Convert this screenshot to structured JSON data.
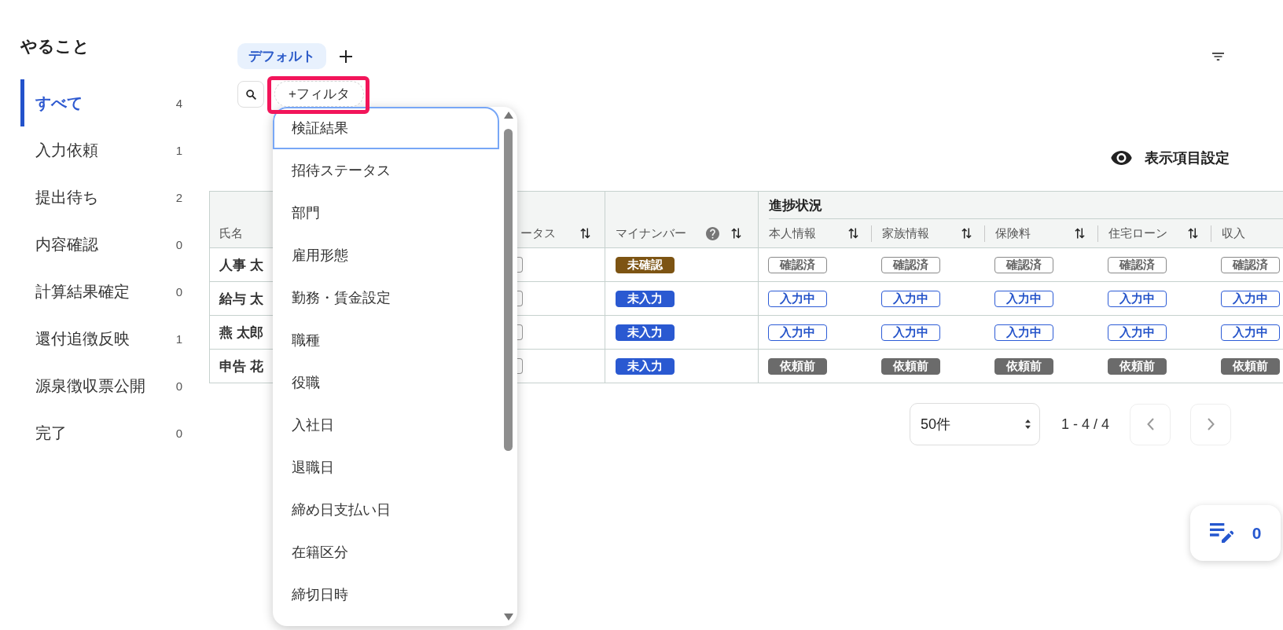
{
  "sidebar": {
    "title": "やること",
    "items": [
      {
        "label": "すべて",
        "count": "4",
        "selected": true
      },
      {
        "label": "入力依頼",
        "count": "1",
        "selected": false
      },
      {
        "label": "提出待ち",
        "count": "2",
        "selected": false
      },
      {
        "label": "内容確認",
        "count": "0",
        "selected": false
      },
      {
        "label": "計算結果確定",
        "count": "0",
        "selected": false
      },
      {
        "label": "還付追徴反映",
        "count": "1",
        "selected": false
      },
      {
        "label": "源泉徴収票公開",
        "count": "0",
        "selected": false
      },
      {
        "label": "完了",
        "count": "0",
        "selected": false
      }
    ]
  },
  "view_tabs": [
    {
      "label": "デフォルト",
      "selected": true
    }
  ],
  "filter_button": {
    "label": "+フィルタ",
    "highlighted": true
  },
  "filter_menu": {
    "items": [
      {
        "label": "検証結果",
        "selected": true
      },
      {
        "label": "招待ステータス",
        "selected": false
      },
      {
        "label": "部門",
        "selected": false
      },
      {
        "label": "雇用形態",
        "selected": false
      },
      {
        "label": "勤務・賃金設定",
        "selected": false
      },
      {
        "label": "職種",
        "selected": false
      },
      {
        "label": "役職",
        "selected": false
      },
      {
        "label": "入社日",
        "selected": false
      },
      {
        "label": "退職日",
        "selected": false
      },
      {
        "label": "締め日支払い日",
        "selected": false
      },
      {
        "label": "在籍区分",
        "selected": false
      },
      {
        "label": "締切日時",
        "selected": false
      }
    ]
  },
  "display_settings": {
    "label": "表示項目設定"
  },
  "table": {
    "columns": [
      {
        "label": "氏名",
        "sortable": false,
        "help": false
      },
      {
        "label": "ータス",
        "sortable": true,
        "help": false
      },
      {
        "label": "マイナンバー",
        "sortable": true,
        "help": true
      }
    ],
    "progress_group": {
      "label": "進捗状況",
      "columns": [
        {
          "label": "本人情報",
          "sortable": true
        },
        {
          "label": "家族情報",
          "sortable": true
        },
        {
          "label": "保険料",
          "sortable": true
        },
        {
          "label": "住宅ローン",
          "sortable": true
        },
        {
          "label": "収入",
          "sortable": false
        }
      ]
    },
    "rows": [
      {
        "name": "人事 太",
        "my_number": {
          "label": "未確認",
          "kind": "unconfirmed"
        },
        "progress": [
          {
            "label": "確認済",
            "kind": "confirmed"
          },
          {
            "label": "確認済",
            "kind": "confirmed"
          },
          {
            "label": "確認済",
            "kind": "confirmed"
          },
          {
            "label": "確認済",
            "kind": "confirmed"
          },
          {
            "label": "確認済",
            "kind": "confirmed"
          }
        ]
      },
      {
        "name": "給与 太",
        "my_number": {
          "label": "未入力",
          "kind": "not_entered"
        },
        "progress": [
          {
            "label": "入力中",
            "kind": "in_progress"
          },
          {
            "label": "入力中",
            "kind": "in_progress"
          },
          {
            "label": "入力中",
            "kind": "in_progress"
          },
          {
            "label": "入力中",
            "kind": "in_progress"
          },
          {
            "label": "入力中",
            "kind": "in_progress"
          }
        ]
      },
      {
        "name": "燕 太郎",
        "my_number": {
          "label": "未入力",
          "kind": "not_entered"
        },
        "progress": [
          {
            "label": "入力中",
            "kind": "in_progress"
          },
          {
            "label": "入力中",
            "kind": "in_progress"
          },
          {
            "label": "入力中",
            "kind": "in_progress"
          },
          {
            "label": "入力中",
            "kind": "in_progress"
          },
          {
            "label": "入力中",
            "kind": "in_progress"
          }
        ]
      },
      {
        "name": "申告 花",
        "my_number": {
          "label": "未入力",
          "kind": "not_entered"
        },
        "progress": [
          {
            "label": "依頼前",
            "kind": "not_requested"
          },
          {
            "label": "依頼前",
            "kind": "not_requested"
          },
          {
            "label": "依頼前",
            "kind": "not_requested"
          },
          {
            "label": "依頼前",
            "kind": "not_requested"
          },
          {
            "label": "依頼前",
            "kind": "not_requested"
          }
        ]
      }
    ]
  },
  "pagination": {
    "page_size": "50件",
    "range": "1 - 4 / 4"
  },
  "edit_list_button": {
    "count": "0"
  }
}
